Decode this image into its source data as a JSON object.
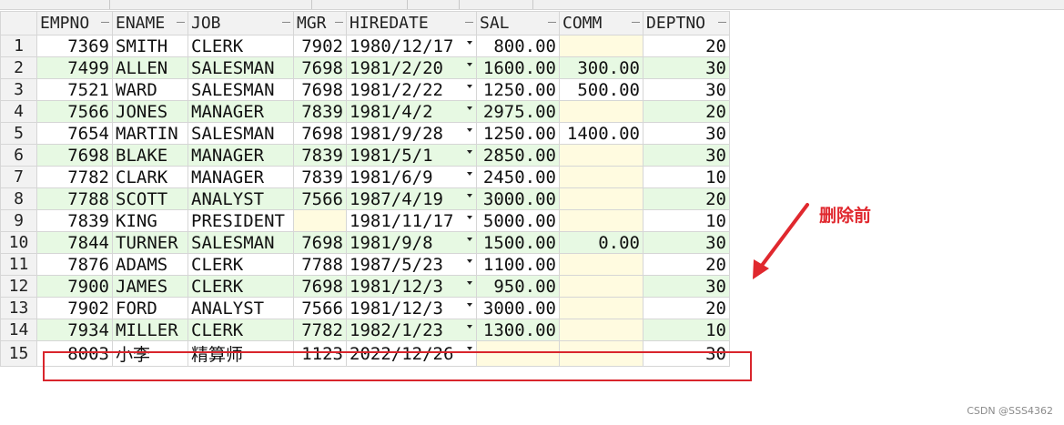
{
  "columns": [
    "EMPNO",
    "ENAME",
    "JOB",
    "MGR",
    "HIREDATE",
    "SAL",
    "COMM",
    "DEPTNO"
  ],
  "rows": [
    {
      "n": "1",
      "empno": "7369",
      "ename": "SMITH",
      "job": "CLERK",
      "mgr": "7902",
      "hiredate": "1980/12/17",
      "sal": "800.00",
      "comm": "",
      "deptno": "20"
    },
    {
      "n": "2",
      "empno": "7499",
      "ename": "ALLEN",
      "job": "SALESMAN",
      "mgr": "7698",
      "hiredate": "1981/2/20",
      "sal": "1600.00",
      "comm": "300.00",
      "deptno": "30"
    },
    {
      "n": "3",
      "empno": "7521",
      "ename": "WARD",
      "job": "SALESMAN",
      "mgr": "7698",
      "hiredate": "1981/2/22",
      "sal": "1250.00",
      "comm": "500.00",
      "deptno": "30"
    },
    {
      "n": "4",
      "empno": "7566",
      "ename": "JONES",
      "job": "MANAGER",
      "mgr": "7839",
      "hiredate": "1981/4/2",
      "sal": "2975.00",
      "comm": "",
      "deptno": "20"
    },
    {
      "n": "5",
      "empno": "7654",
      "ename": "MARTIN",
      "job": "SALESMAN",
      "mgr": "7698",
      "hiredate": "1981/9/28",
      "sal": "1250.00",
      "comm": "1400.00",
      "deptno": "30"
    },
    {
      "n": "6",
      "empno": "7698",
      "ename": "BLAKE",
      "job": "MANAGER",
      "mgr": "7839",
      "hiredate": "1981/5/1",
      "sal": "2850.00",
      "comm": "",
      "deptno": "30"
    },
    {
      "n": "7",
      "empno": "7782",
      "ename": "CLARK",
      "job": "MANAGER",
      "mgr": "7839",
      "hiredate": "1981/6/9",
      "sal": "2450.00",
      "comm": "",
      "deptno": "10"
    },
    {
      "n": "8",
      "empno": "7788",
      "ename": "SCOTT",
      "job": "ANALYST",
      "mgr": "7566",
      "hiredate": "1987/4/19",
      "sal": "3000.00",
      "comm": "",
      "deptno": "20"
    },
    {
      "n": "9",
      "empno": "7839",
      "ename": "KING",
      "job": "PRESIDENT",
      "mgr": "",
      "hiredate": "1981/11/17",
      "sal": "5000.00",
      "comm": "",
      "deptno": "10"
    },
    {
      "n": "10",
      "empno": "7844",
      "ename": "TURNER",
      "job": "SALESMAN",
      "mgr": "7698",
      "hiredate": "1981/9/8",
      "sal": "1500.00",
      "comm": "0.00",
      "deptno": "30"
    },
    {
      "n": "11",
      "empno": "7876",
      "ename": "ADAMS",
      "job": "CLERK",
      "mgr": "7788",
      "hiredate": "1987/5/23",
      "sal": "1100.00",
      "comm": "",
      "deptno": "20"
    },
    {
      "n": "12",
      "empno": "7900",
      "ename": "JAMES",
      "job": "CLERK",
      "mgr": "7698",
      "hiredate": "1981/12/3",
      "sal": "950.00",
      "comm": "",
      "deptno": "30"
    },
    {
      "n": "13",
      "empno": "7902",
      "ename": "FORD",
      "job": "ANALYST",
      "mgr": "7566",
      "hiredate": "1981/12/3",
      "sal": "3000.00",
      "comm": "",
      "deptno": "20"
    },
    {
      "n": "14",
      "empno": "7934",
      "ename": "MILLER",
      "job": "CLERK",
      "mgr": "7782",
      "hiredate": "1982/1/23",
      "sal": "1300.00",
      "comm": "",
      "deptno": "10"
    },
    {
      "n": "15",
      "empno": "8003",
      "ename": "小李",
      "job": "精算师",
      "mgr": "1123",
      "hiredate": "2022/12/26",
      "sal": "",
      "comm": "",
      "deptno": "30"
    }
  ],
  "annotation": {
    "text": "删除前",
    "color": "#e0282e"
  },
  "highlight_color": "#d9252c",
  "colors": {
    "row_even": "#e7f9e3",
    "row_odd": "#ffffff",
    "null_cell": "#fffbe0",
    "header": "#f2f2f2"
  },
  "watermark": "CSDN @SSS4362"
}
